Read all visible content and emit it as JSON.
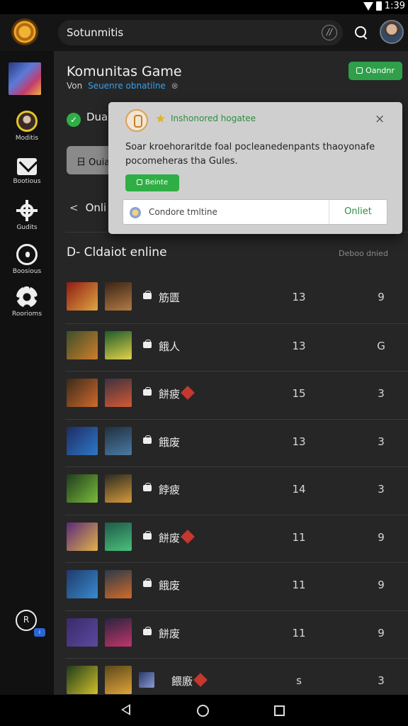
{
  "status_bar": {
    "time": "1:39"
  },
  "header": {
    "search_label": "Sotunmitis",
    "mic_glyph": "//"
  },
  "sidebar": {
    "items": [
      {
        "label": "Moditis"
      },
      {
        "label": "Bootious"
      },
      {
        "label": "Gudits"
      },
      {
        "label": "Boosious"
      },
      {
        "label": "Roorioms"
      }
    ],
    "bottom_glyph": "R",
    "bottom_badge": "i"
  },
  "main": {
    "title": "Komunitas Game",
    "subtitle_prefix": "Von",
    "subtitle_link": "Seuenre obnatilne",
    "subtitle_dot": "⊗",
    "online_button": "Oandnr",
    "dual_label": "Dual",
    "gray_pill_label": "Ouial",
    "back_label": "Onli",
    "section_title": "D- Cldaiot enline",
    "section_right": "Deboo dnied"
  },
  "games": [
    {
      "name": "筋匮",
      "col_a": "13",
      "col_b": "9",
      "flare": false,
      "extra_thumb": false,
      "colors": [
        "#8e1c12",
        "#e1a542",
        "#3a2516",
        "#b37a44"
      ]
    },
    {
      "name": "餓人",
      "col_a": "13",
      "col_b": "G",
      "flare": false,
      "extra_thumb": false,
      "colors": [
        "#3b4f2b",
        "#d07e2a",
        "#1e5b2a",
        "#e2d24b"
      ]
    },
    {
      "name": "餅疲",
      "col_a": "15",
      "col_b": "3",
      "flare": true,
      "extra_thumb": false,
      "colors": [
        "#3a2a1c",
        "#d06a2a",
        "#3f3140",
        "#d35a34"
      ]
    },
    {
      "name": "餓废",
      "col_a": "13",
      "col_b": "3",
      "flare": false,
      "extra_thumb": false,
      "colors": [
        "#1e2c62",
        "#2e78c9",
        "#20303e",
        "#4a7aa5"
      ]
    },
    {
      "name": "餑疲",
      "col_a": "14",
      "col_b": "3",
      "flare": false,
      "extra_thumb": false,
      "colors": [
        "#1f3c1e",
        "#7abc3a",
        "#2b2a22",
        "#d59a3a"
      ]
    },
    {
      "name": "餅废",
      "col_a": "11",
      "col_b": "9",
      "flare": true,
      "extra_thumb": false,
      "colors": [
        "#5a2a7a",
        "#e2b24a",
        "#1f5a4a",
        "#4ac07a"
      ]
    },
    {
      "name": "餓废",
      "col_a": "11",
      "col_b": "9",
      "flare": false,
      "extra_thumb": false,
      "colors": [
        "#1e3a6a",
        "#3a8ad0",
        "#2a3a4a",
        "#d26a2a"
      ]
    },
    {
      "name": "餅废",
      "col_a": "11",
      "col_b": "9",
      "flare": false,
      "extra_thumb": false,
      "colors": [
        "#3a2a6a",
        "#5a4aa0",
        "#2a2440",
        "#c0356a"
      ]
    },
    {
      "name": "餵廒",
      "col_a": "s",
      "col_b": "3",
      "flare": true,
      "extra_thumb": true,
      "colors": [
        "#1e3a1a",
        "#d0c02a",
        "#5a4a1a",
        "#e2a23a"
      ]
    }
  ],
  "popup": {
    "star": "★",
    "title": "Inshonored hogatee",
    "close": "×",
    "body": "Soar kroehoraritde foal pocleanedenpants thaoyonafe pocomeheras tha Gules.",
    "button": "Beinte",
    "input_placeholder": "Condore tmltine",
    "input_button": "Onliet"
  }
}
